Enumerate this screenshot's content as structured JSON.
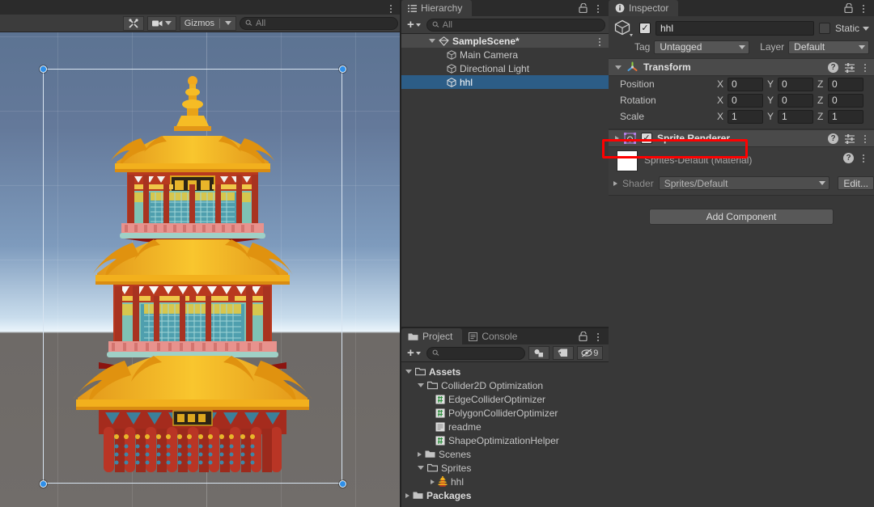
{
  "scene_view": {
    "toolbar": {
      "tools_icon": "tools-icon",
      "camera_icon": "camera-icon",
      "gizmos_label": "Gizmos",
      "search_placeholder": "All",
      "search_value": "",
      "search_icon": "search-icon",
      "kebab_icon": "kebab-menu-icon"
    },
    "sprite": {
      "name": "hhl",
      "description": "Chinese pagoda sprite (Yellow Crane Tower)",
      "plaque_top": "黄鹤楼",
      "plaque_bottom": "楠木厦"
    },
    "selection": {
      "handle_count": 4,
      "handle_color": "#2f8fe8",
      "outline_color": "#d8e4f0"
    },
    "background": {
      "sky_top": "#5c7392",
      "horizon": "#eaf4fb",
      "ground": "#6e6a67"
    }
  },
  "hierarchy": {
    "tab_label": "Hierarchy",
    "tab_icon": "hierarchy-icon",
    "lock_icon": "lock-icon",
    "kebab_icon": "kebab-menu-icon",
    "toolbar": {
      "create_label": "+",
      "search_placeholder": "All",
      "search_value": "",
      "search_icon": "search-icon"
    },
    "items": [
      {
        "label": "SampleScene*",
        "icon": "scene-icon",
        "depth": 0,
        "expanded": true,
        "selected": false,
        "is_scene": true
      },
      {
        "label": "Main Camera",
        "icon": "gameobject-icon",
        "depth": 1,
        "expanded": false,
        "selected": false,
        "is_scene": false
      },
      {
        "label": "Directional Light",
        "icon": "gameobject-icon",
        "depth": 1,
        "expanded": false,
        "selected": false,
        "is_scene": false
      },
      {
        "label": "hhl",
        "icon": "gameobject-icon",
        "depth": 1,
        "expanded": false,
        "selected": true,
        "is_scene": false
      }
    ]
  },
  "project": {
    "tabs": [
      {
        "label": "Project",
        "icon": "folder-icon",
        "active": true
      },
      {
        "label": "Console",
        "icon": "console-icon",
        "active": false
      }
    ],
    "lock_icon": "lock-icon",
    "kebab_icon": "kebab-menu-icon",
    "toolbar": {
      "create_label": "+",
      "search_placeholder": "",
      "search_value": "",
      "search_icon": "search-icon",
      "filter_type_icon": "filter-by-type-icon",
      "filter_label_icon": "filter-by-label-icon",
      "hidden_icon": "hidden-packages-icon",
      "hidden_count": "9"
    },
    "tree": [
      {
        "label": "Assets",
        "icon": "folder-open-icon",
        "depth": 0,
        "expanded": true,
        "bold": true
      },
      {
        "label": "Collider2D Optimization",
        "icon": "folder-open-icon",
        "depth": 1,
        "expanded": true,
        "bold": false
      },
      {
        "label": "EdgeColliderOptimizer",
        "icon": "csharp-script-icon",
        "depth": 2,
        "expanded": null,
        "bold": false
      },
      {
        "label": "PolygonColliderOptimizer",
        "icon": "csharp-script-icon",
        "depth": 2,
        "expanded": null,
        "bold": false
      },
      {
        "label": "readme",
        "icon": "text-file-icon",
        "depth": 2,
        "expanded": null,
        "bold": false
      },
      {
        "label": "ShapeOptimizationHelper",
        "icon": "csharp-script-icon",
        "depth": 2,
        "expanded": null,
        "bold": false
      },
      {
        "label": "Scenes",
        "icon": "folder-icon",
        "depth": 1,
        "expanded": false,
        "bold": false
      },
      {
        "label": "Sprites",
        "icon": "folder-open-icon",
        "depth": 1,
        "expanded": true,
        "bold": false
      },
      {
        "label": "hhl",
        "icon": "sprite-thumbnail-icon",
        "depth": 2,
        "expanded": false,
        "bold": false
      },
      {
        "label": "Packages",
        "icon": "folder-icon",
        "depth": 0,
        "expanded": false,
        "bold": true
      }
    ]
  },
  "inspector": {
    "tab_label": "Inspector",
    "tab_icon": "info-icon",
    "lock_icon": "lock-icon",
    "kebab_icon": "kebab-menu-icon",
    "gameobject": {
      "icon": "gameobject-cube-icon",
      "enabled": true,
      "name_value": "hhl",
      "static_label": "Static",
      "static_checked": false,
      "tag_label": "Tag",
      "tag_value": "Untagged",
      "layer_label": "Layer",
      "layer_value": "Default"
    },
    "transform": {
      "title": "Transform",
      "icon": "transform-gizmo-icon",
      "expanded": true,
      "help_icon": "help-icon",
      "preset_icon": "preset-sliders-icon",
      "kebab_icon": "kebab-menu-icon",
      "rows": [
        {
          "label": "Position",
          "x": "0",
          "y": "0",
          "z": "0"
        },
        {
          "label": "Rotation",
          "x": "0",
          "y": "0",
          "z": "0"
        },
        {
          "label": "Scale",
          "x": "1",
          "y": "1",
          "z": "1"
        }
      ],
      "axis_labels": [
        "X",
        "Y",
        "Z"
      ]
    },
    "sprite_renderer": {
      "title": "Sprite Renderer",
      "icon": "sprite-renderer-icon",
      "enabled": true,
      "expanded": false,
      "highlighted": true,
      "highlight_color": "#ff0000",
      "help_icon": "help-icon",
      "preset_icon": "preset-sliders-icon",
      "kebab_icon": "kebab-menu-icon"
    },
    "material": {
      "name": "Sprites-Default (Material)",
      "swatch_color": "#ffffff",
      "shader_label": "Shader",
      "shader_value": "Sprites/Default",
      "edit_label": "Edit...",
      "help_icon": "help-icon",
      "kebab_icon": "kebab-menu-icon"
    },
    "add_component_label": "Add Component"
  }
}
